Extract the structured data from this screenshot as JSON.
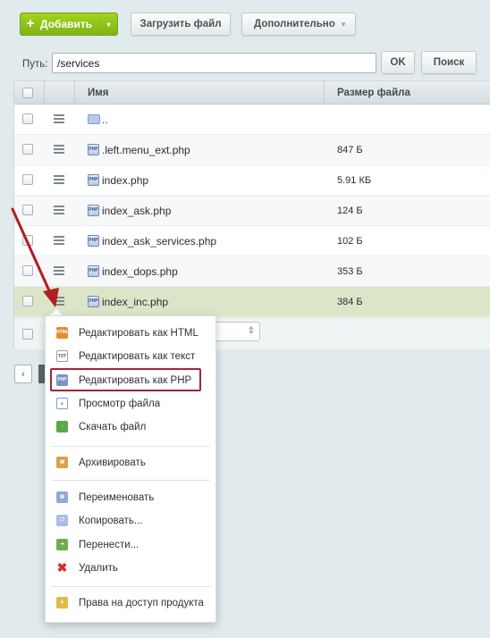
{
  "toolbar": {
    "add_label": "Добавить",
    "upload_label": "Загрузить файл",
    "more_label": "Дополнительно"
  },
  "path": {
    "label": "Путь:",
    "value": "/services",
    "ok_label": "OK",
    "search_label": "Поиск"
  },
  "table": {
    "col_name": "Имя",
    "col_size": "Размер файла",
    "rows": [
      {
        "name": "..",
        "size": ""
      },
      {
        "name": ".left.menu_ext.php",
        "size": "847 Б"
      },
      {
        "name": "index.php",
        "size": "5.91 КБ"
      },
      {
        "name": "index_ask.php",
        "size": "124 Б"
      },
      {
        "name": "index_ask_services.php",
        "size": "102 Б"
      },
      {
        "name": "index_dops.php",
        "size": "353 Б"
      },
      {
        "name": "index_inc.php",
        "size": "384 Б"
      }
    ]
  },
  "context_menu": {
    "items": [
      {
        "label": "Редактировать как HTML",
        "icon": "html-file-icon"
      },
      {
        "label": "Редактировать как текст",
        "icon": "txt-file-icon"
      },
      {
        "label": "Редактировать как PHP",
        "icon": "php-file-icon"
      },
      {
        "label": "Просмотр файла",
        "icon": "magnifier-icon"
      },
      {
        "label": "Скачать файл",
        "icon": "download-icon"
      },
      {
        "label": "Архивировать",
        "icon": "archive-box-icon"
      },
      {
        "label": "Переименовать",
        "icon": "rename-icon"
      },
      {
        "label": "Копировать...",
        "icon": "copy-icon"
      },
      {
        "label": "Перенести...",
        "icon": "move-icon"
      },
      {
        "label": "Удалить",
        "icon": "delete-x-icon"
      },
      {
        "label": "Права на доступ продукта",
        "icon": "user-lock-icon"
      }
    ]
  },
  "colors": {
    "accent_green": "#8cc21a",
    "highlight_red": "#a4243b",
    "selected_row": "#dde5c8"
  }
}
